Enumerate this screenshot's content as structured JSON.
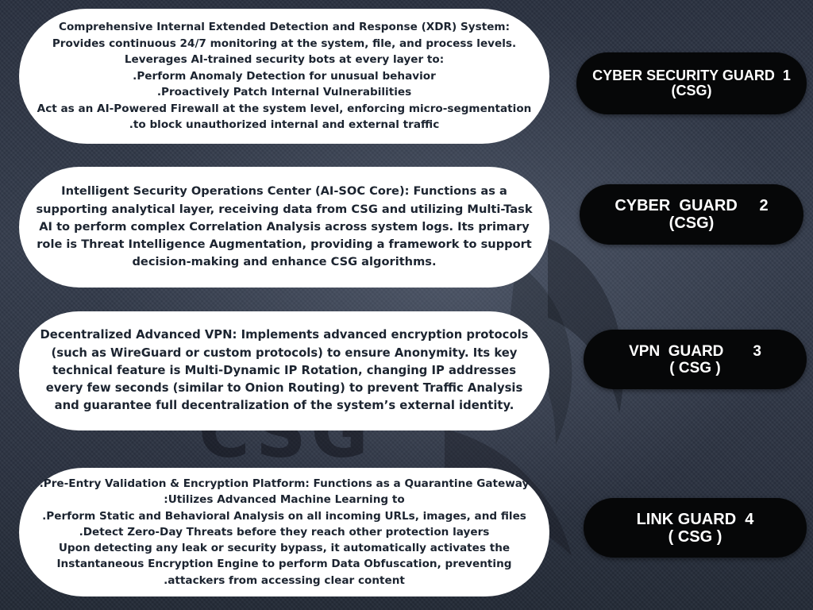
{
  "colors": {
    "background": "#2f3646",
    "card_background": "#ffffff",
    "card_text": "#1c2430",
    "pill_background": "#060708",
    "pill_text": "#ffffff"
  },
  "cards": [
    {
      "lines": [
        "Comprehensive Internal Extended Detection and Response (XDR) System:",
        "Provides continuous 24/7 monitoring at the system, file, and process levels.",
        "Leverages AI-trained security bots at every layer to:",
        ".Perform Anomaly Detection for unusual behavior",
        ".Proactively Patch Internal Vulnerabilities",
        "Act as an AI-Powered Firewall at the system level, enforcing micro-segmentation",
        ".to block unauthorized internal and external traffic"
      ]
    },
    {
      "lines": [
        "Intelligent Security Operations Center (AI-SOC Core): Functions as a",
        "supporting analytical layer, receiving data from CSG and utilizing Multi-Task",
        "AI to perform complex Correlation Analysis across system logs. Its primary",
        "role is Threat Intelligence Augmentation, providing a framework to support",
        "decision-making and enhance CSG algorithms."
      ]
    },
    {
      "lines": [
        "Decentralized Advanced VPN: Implements advanced encryption protocols",
        "(such as WireGuard or custom protocols) to ensure Anonymity. Its key",
        "technical feature is Multi-Dynamic IP Rotation, changing IP addresses",
        "every few seconds (similar to Onion Routing) to prevent Traffic Analysis",
        "and guarantee full decentralization of the system’s external identity."
      ]
    },
    {
      "lines": [
        ".Pre-Entry Validation & Encryption Platform: Functions as a Quarantine Gateway",
        ":Utilizes Advanced Machine Learning to",
        ".Perform Static and Behavioral Analysis on all incoming URLs, images, and files",
        ".Detect Zero-Day Threats before they reach other protection layers",
        "Upon detecting any leak or security bypass, it automatically activates the",
        "Instantaneous Encryption Engine to perform Data Obfuscation, preventing",
        ".attackers from accessing clear content"
      ]
    }
  ],
  "guards": [
    {
      "title": "CYBER SECURITY GUARD  1",
      "subtitle": "(CSG)"
    },
    {
      "title": "CYBER  GUARD     2",
      "subtitle": "(CSG)"
    },
    {
      "title": "VPN  GUARD       3",
      "subtitle": "( CSG )"
    },
    {
      "title": "LINK GUARD  4",
      "subtitle": "( CSG )"
    }
  ]
}
